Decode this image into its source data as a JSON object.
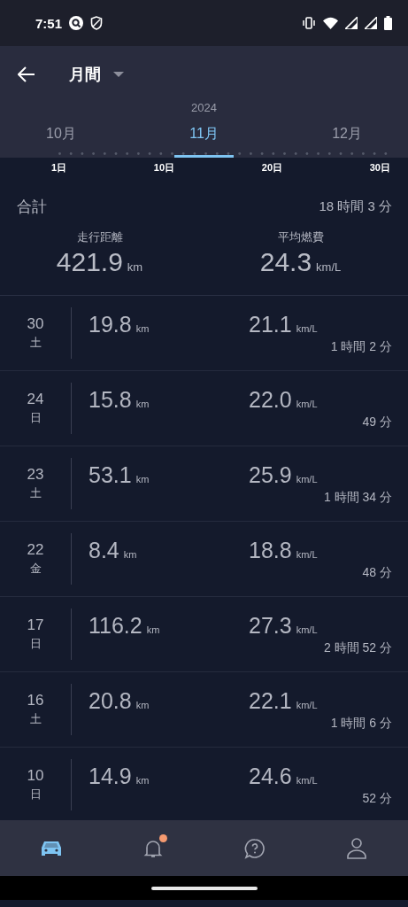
{
  "status_bar": {
    "time": "7:51"
  },
  "header": {
    "title": "月間",
    "year": "2024"
  },
  "month_tabs": [
    {
      "label": "10月",
      "selected": false
    },
    {
      "label": "11月",
      "selected": true
    },
    {
      "label": "12月",
      "selected": false
    }
  ],
  "day_axis": [
    "1日",
    "10日",
    "20日",
    "30日"
  ],
  "summary": {
    "label": "合計",
    "duration": "18 時間 3 分",
    "distance_label": "走行距離",
    "distance": "421.9",
    "distance_unit": "km",
    "economy_label": "平均燃費",
    "economy": "24.3",
    "economy_unit": "km/L"
  },
  "trips": [
    {
      "day": "30",
      "weekday": "土",
      "distance": "19.8",
      "distance_unit": "km",
      "economy": "21.1",
      "economy_unit": "km/L",
      "duration": "1 時間 2 分"
    },
    {
      "day": "24",
      "weekday": "日",
      "distance": "15.8",
      "distance_unit": "km",
      "economy": "22.0",
      "economy_unit": "km/L",
      "duration": "49 分"
    },
    {
      "day": "23",
      "weekday": "土",
      "distance": "53.1",
      "distance_unit": "km",
      "economy": "25.9",
      "economy_unit": "km/L",
      "duration": "1 時間 34 分"
    },
    {
      "day": "22",
      "weekday": "金",
      "distance": "8.4",
      "distance_unit": "km",
      "economy": "18.8",
      "economy_unit": "km/L",
      "duration": "48 分"
    },
    {
      "day": "17",
      "weekday": "日",
      "distance": "116.2",
      "distance_unit": "km",
      "economy": "27.3",
      "economy_unit": "km/L",
      "duration": "2 時間 52 分"
    },
    {
      "day": "16",
      "weekday": "土",
      "distance": "20.8",
      "distance_unit": "km",
      "economy": "22.1",
      "economy_unit": "km/L",
      "duration": "1 時間 6 分"
    },
    {
      "day": "10",
      "weekday": "日",
      "distance": "14.9",
      "distance_unit": "km",
      "economy": "24.6",
      "economy_unit": "km/L",
      "duration": "52 分"
    }
  ],
  "bottom_nav": [
    {
      "kind": "car",
      "selected": true,
      "badge": false
    },
    {
      "kind": "bell",
      "selected": false,
      "badge": true
    },
    {
      "kind": "help",
      "selected": false,
      "badge": false
    },
    {
      "kind": "person",
      "selected": false,
      "badge": false
    }
  ]
}
